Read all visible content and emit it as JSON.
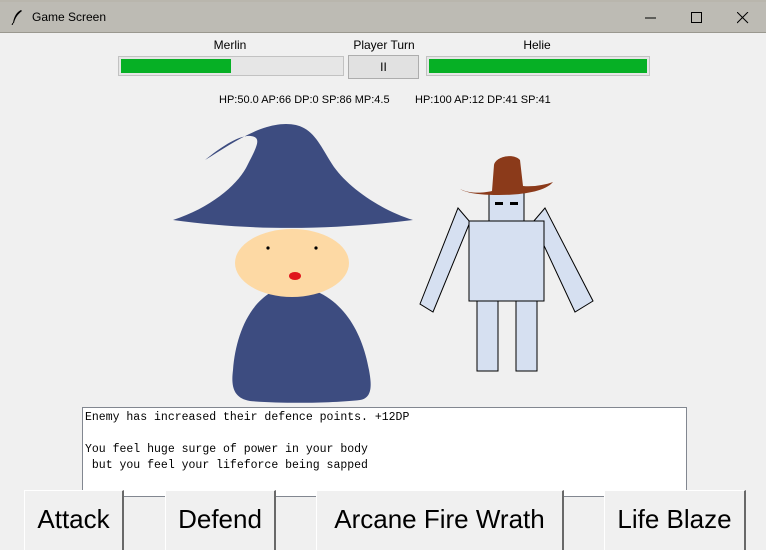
{
  "window": {
    "title": "Game Screen",
    "controls": [
      "minimize-icon",
      "maximize-icon",
      "close-icon"
    ]
  },
  "header": {
    "player_name": "Merlin",
    "turn_label": "Player Turn",
    "enemy_name": "Helie",
    "pause_label": "II"
  },
  "player": {
    "stats": "HP:50.0 AP:66 DP:0 SP:86 MP:4.5",
    "hp_fraction": 0.5
  },
  "enemy": {
    "stats": "HP:100 AP:12 DP:41 SP:41",
    "hp_fraction": 1.0
  },
  "log": {
    "text": "Enemy has increased their defence points. +12DP\n\nYou feel huge surge of power in your body\n but you feel your lifeforce being sapped"
  },
  "actions": [
    "Attack",
    "Defend",
    "Arcane Fire Wrath",
    "Life Blaze"
  ],
  "colors": {
    "hp_bar": "#06b025",
    "wizard_robe": "#3d4c80",
    "wizard_skin": "#fdd9a4",
    "robot_body": "#d6e0f1",
    "cowboy_hat": "#8b3a1a"
  }
}
